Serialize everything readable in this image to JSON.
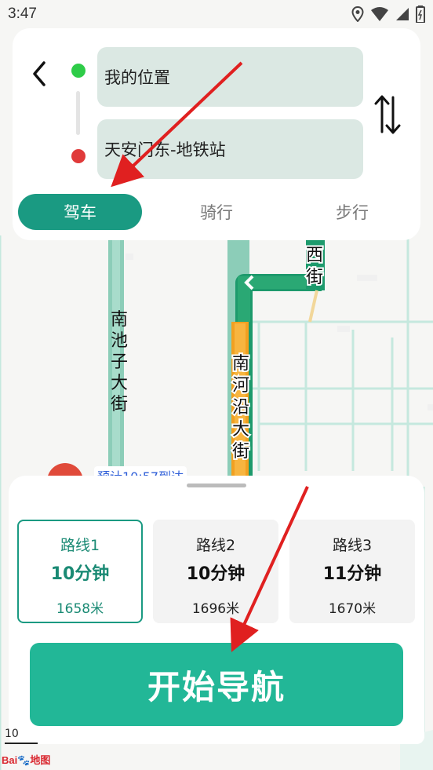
{
  "status_bar": {
    "time": "3:47"
  },
  "route_input": {
    "start": "我的位置",
    "destination": "天安门东-地铁站"
  },
  "travel_modes": [
    {
      "label": "驾车",
      "active": true
    },
    {
      "label": "骑行",
      "active": false
    },
    {
      "label": "步行",
      "active": false
    }
  ],
  "map": {
    "street_labels": [
      "南池子大街",
      "南河沿大街",
      "西街"
    ],
    "poi_label": "预计10:57到达",
    "scale_label": "10",
    "logo": "Bai地图"
  },
  "routes": [
    {
      "name": "路线1",
      "time": "10分钟",
      "distance": "1658米",
      "selected": true
    },
    {
      "name": "路线2",
      "time": "10分钟",
      "distance": "1696米",
      "selected": false
    },
    {
      "name": "路线3",
      "time": "11分钟",
      "distance": "1670米",
      "selected": false
    }
  ],
  "start_navigation_label": "开始导航",
  "colors": {
    "accent": "#1a9a82",
    "nav_button": "#22b797",
    "start_dot": "#2ecc48",
    "end_dot": "#e03a3a",
    "annotation_arrow": "#e02020"
  }
}
